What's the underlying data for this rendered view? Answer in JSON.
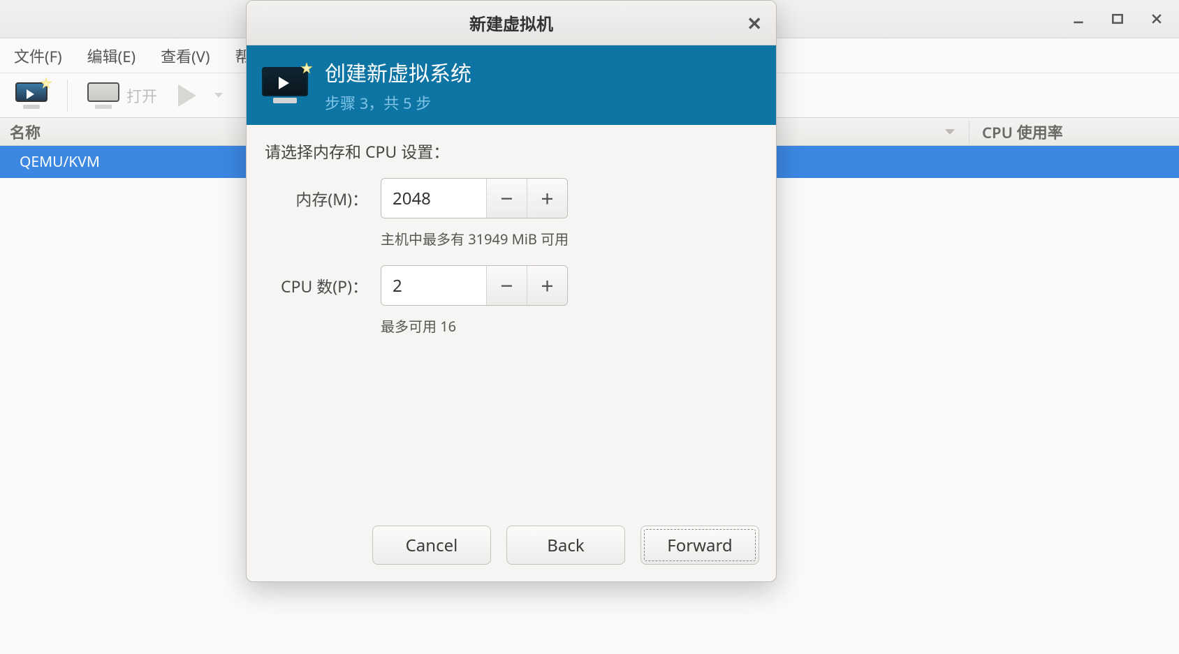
{
  "mainWindow": {
    "menus": {
      "file": "文件(F)",
      "edit": "编辑(E)",
      "view": "查看(V)",
      "help": "帮助"
    },
    "toolbar": {
      "openLabel": "打开"
    },
    "columns": {
      "name": "名称",
      "cpu": "CPU 使用率"
    },
    "rows": [
      {
        "name": "QEMU/KVM"
      }
    ]
  },
  "dialog": {
    "title": "新建虚拟机",
    "banner": {
      "heading": "创建新虚拟系统",
      "step": "步骤 3，共 5 步"
    },
    "lead": "请选择内存和 CPU 设置：",
    "memory": {
      "label": "内存(M)：",
      "value": "2048",
      "hint": "主机中最多有 31949 MiB 可用"
    },
    "cpu": {
      "label": "CPU 数(P)：",
      "value": "2",
      "hint": "最多可用 16"
    },
    "actions": {
      "cancel": "Cancel",
      "back": "Back",
      "forward": "Forward"
    }
  }
}
